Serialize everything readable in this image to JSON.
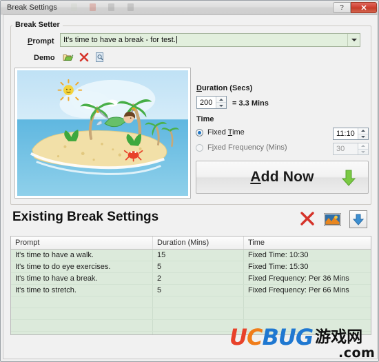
{
  "window": {
    "title": "Break Settings",
    "help_button": "?",
    "close_button": "✕"
  },
  "break_setter": {
    "group_title": "Break Setter",
    "prompt_label": "Prompt",
    "prompt_label_accel": "P",
    "prompt_value": "It's time to have a break - for test.",
    "demo_label": "Demo",
    "demo_icons": [
      "open-folder-icon",
      "delete-red-x-icon",
      "preview-document-icon"
    ],
    "preview_image_alt": "beach-island-illustration"
  },
  "duration": {
    "label": "Duration (Secs)",
    "label_accel": "D",
    "value": "200",
    "converted": "= 3.3 Mins"
  },
  "time": {
    "label": "Time",
    "fixed_time_label": "Fixed Time",
    "fixed_time_accel": "T",
    "fixed_time_value": "11:10",
    "fixed_time_selected": true,
    "fixed_frequency_label": "Fixed Frequency (Mins)",
    "fixed_frequency_value": "30",
    "fixed_frequency_selected": false
  },
  "add_now": {
    "label": "Add Now",
    "label_accel": "A",
    "arrow_icon": "arrow-down-green-icon"
  },
  "existing": {
    "title": "Existing Break Settings",
    "delete_icon": "delete-red-x-icon",
    "image_icon": "picture-thumbnail-icon",
    "download_icon": "arrow-down-blue-icon",
    "columns": [
      "Prompt",
      "Duration (Mins)",
      "Time"
    ],
    "rows": [
      {
        "prompt": "It's time to have a walk.",
        "duration": "15",
        "time": "Fixed Time: 10:30"
      },
      {
        "prompt": "It's time to do eye exercises.",
        "duration": "5",
        "time": "Fixed Time: 15:30"
      },
      {
        "prompt": "It's time to have a break.",
        "duration": "2",
        "time": "Fixed Frequency: Per 36 Mins"
      },
      {
        "prompt": "It's time to stretch.",
        "duration": "5",
        "time": "Fixed Frequency: Per 66 Mins"
      }
    ]
  },
  "watermark": {
    "part_u": "U",
    "part_c": "C",
    "part_bug": "BUG",
    "part_cn": "游戏网",
    "part_com": ".com"
  },
  "colors": {
    "accent_green": "#e2efdd",
    "table_bg": "#dceadb",
    "close_red": "#cf3f2f",
    "radio_blue": "#1f74c4"
  }
}
